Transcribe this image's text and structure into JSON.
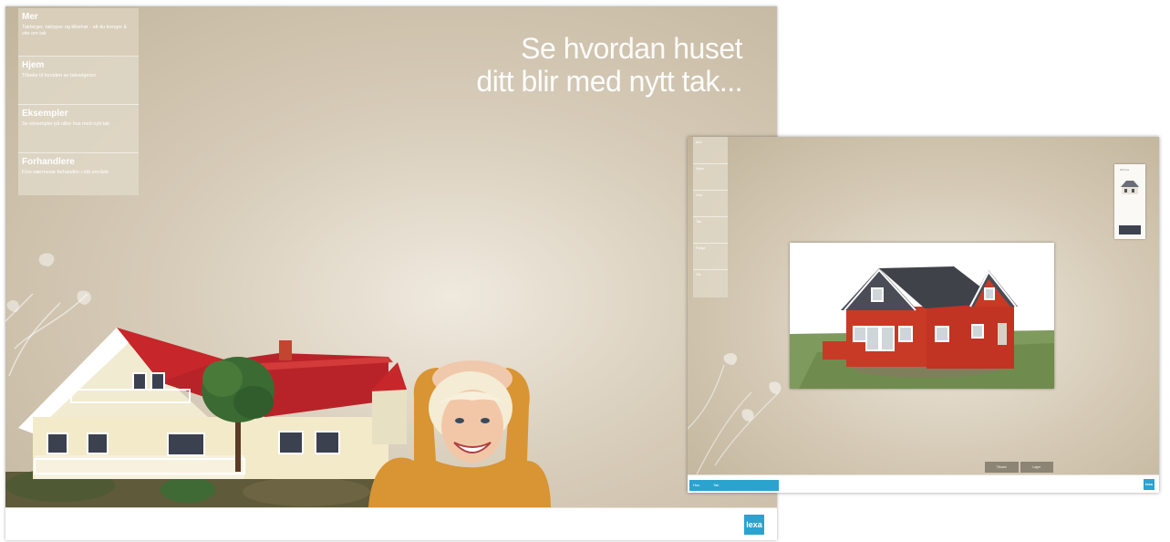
{
  "screen1": {
    "menu": [
      {
        "title": "Mer",
        "desc": "Takfarger, taktyper og tilbehør - alt du trenger å vite om tak",
        "active": true
      },
      {
        "title": "Hjem",
        "desc": "Tilbake til forsiden av takvelgeren",
        "active": false
      },
      {
        "title": "Eksempler",
        "desc": "Se eksempler på ulike hus med nytt tak",
        "active": false
      },
      {
        "title": "Forhandlere",
        "desc": "Finn nærmeste forhandler i ditt område",
        "active": false
      }
    ],
    "tagline": [
      "Se hvordan huset",
      "ditt blir med nytt tak..."
    ],
    "logo": "lexa"
  },
  "screen2": {
    "menu": [
      {
        "label": "Mer"
      },
      {
        "label": "Hjem"
      },
      {
        "label": "Hus"
      },
      {
        "label": "Tak"
      },
      {
        "label": "Farge"
      },
      {
        "label": "Vis"
      }
    ],
    "footer_tabs": [
      "Hus",
      "Tak"
    ],
    "buttons": [
      "Tilbake",
      "Lagre"
    ],
    "thumb_caption": "Ditt hus",
    "logo": "lexa"
  },
  "colors": {
    "accent_blue": "#2aa3cf",
    "roof_red": "#c7262a",
    "wall_red": "#c83a26",
    "roof_grey": "#4a4d55",
    "background_tan": "#cfc3ad"
  }
}
